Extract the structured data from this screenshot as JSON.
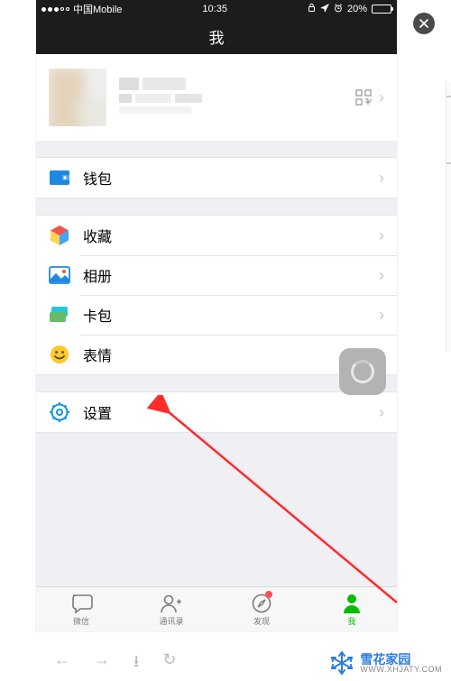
{
  "statusbar": {
    "carrier": "中国Mobile",
    "time": "10:35",
    "battery_pct": "20%"
  },
  "nav": {
    "title": "我"
  },
  "profile": {
    "qr_icon": "qr-code-icon"
  },
  "sections": {
    "wallet": {
      "label": "钱包"
    },
    "favorites": {
      "label": "收藏"
    },
    "album": {
      "label": "相册"
    },
    "cards": {
      "label": "卡包"
    },
    "stickers": {
      "label": "表情"
    },
    "settings": {
      "label": "设置"
    }
  },
  "tabs": {
    "chats": "微信",
    "contacts": "通讯录",
    "discover": "发现",
    "me": "我"
  },
  "watermark": {
    "title": "雪花家园",
    "url": "WWW.XHJATY.COM"
  },
  "colors": {
    "accent_green": "#09bb07",
    "wallet_blue": "#1e88e5",
    "settings_blue": "#1296db",
    "arrow_red": "#ff2a2a"
  }
}
